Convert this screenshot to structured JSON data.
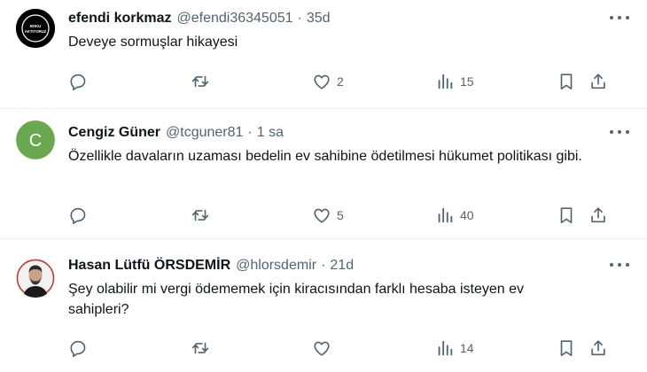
{
  "tweets": [
    {
      "name": "efendi korkmaz",
      "handle": "@efendi36345051",
      "time": "35d",
      "text": "Deveye sormuşlar hikayesi",
      "replies": "",
      "retweets": "",
      "likes": "2",
      "views": "15",
      "avatar_text": "BOKU AKTIYORUZ"
    },
    {
      "name": "Cengiz Güner",
      "handle": "@tcguner81",
      "time": "1 sa",
      "text": "Özellikle davaların uzaması bedelin ev sahibine ödetilmesi hükumet politikası gibi.",
      "replies": "",
      "retweets": "",
      "likes": "5",
      "views": "40",
      "avatar_letter": "C"
    },
    {
      "name": "Hasan Lütfü ÖRSDEMİR",
      "handle": "@hlorsdemir",
      "time": "21d",
      "text": "Şey olabilir mi vergi ödememek için kiracısından farklı hesaba isteyen ev sahipleri?",
      "replies": "",
      "retweets": "",
      "likes": "",
      "views": "14"
    }
  ],
  "separator": "·",
  "colors": {
    "text": "#0f1419",
    "muted": "#536471",
    "divider": "#eff3f4",
    "avatar_green": "#6aa84f"
  },
  "icons": [
    "reply-icon",
    "retweet-icon",
    "like-icon",
    "views-icon",
    "bookmark-icon",
    "share-icon",
    "more-icon"
  ]
}
